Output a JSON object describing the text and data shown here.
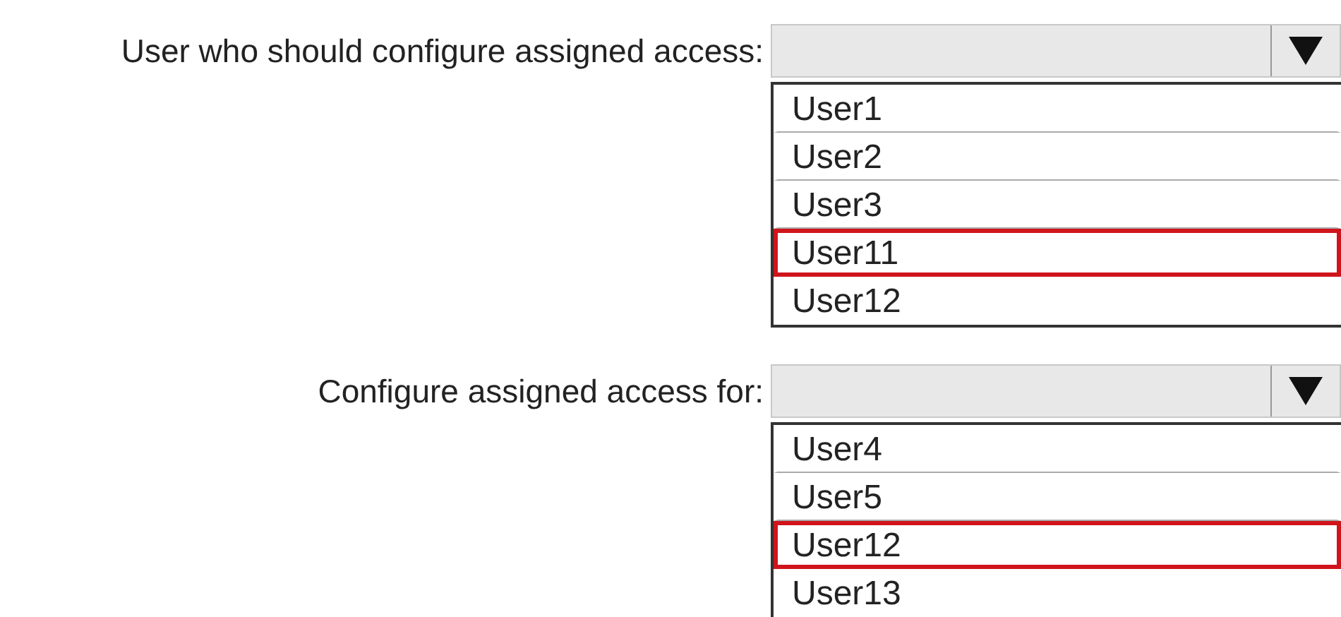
{
  "dropdowns": [
    {
      "label": "User who should configure assigned access:",
      "options": [
        {
          "label": "User1",
          "selected": false
        },
        {
          "label": "User2",
          "selected": false
        },
        {
          "label": "User3",
          "selected": false
        },
        {
          "label": "User11",
          "selected": true
        },
        {
          "label": "User12",
          "selected": false
        }
      ]
    },
    {
      "label": "Configure assigned access for:",
      "options": [
        {
          "label": "User4",
          "selected": false
        },
        {
          "label": "User5",
          "selected": false
        },
        {
          "label": "User12",
          "selected": true
        },
        {
          "label": "User13",
          "selected": false
        }
      ]
    }
  ]
}
